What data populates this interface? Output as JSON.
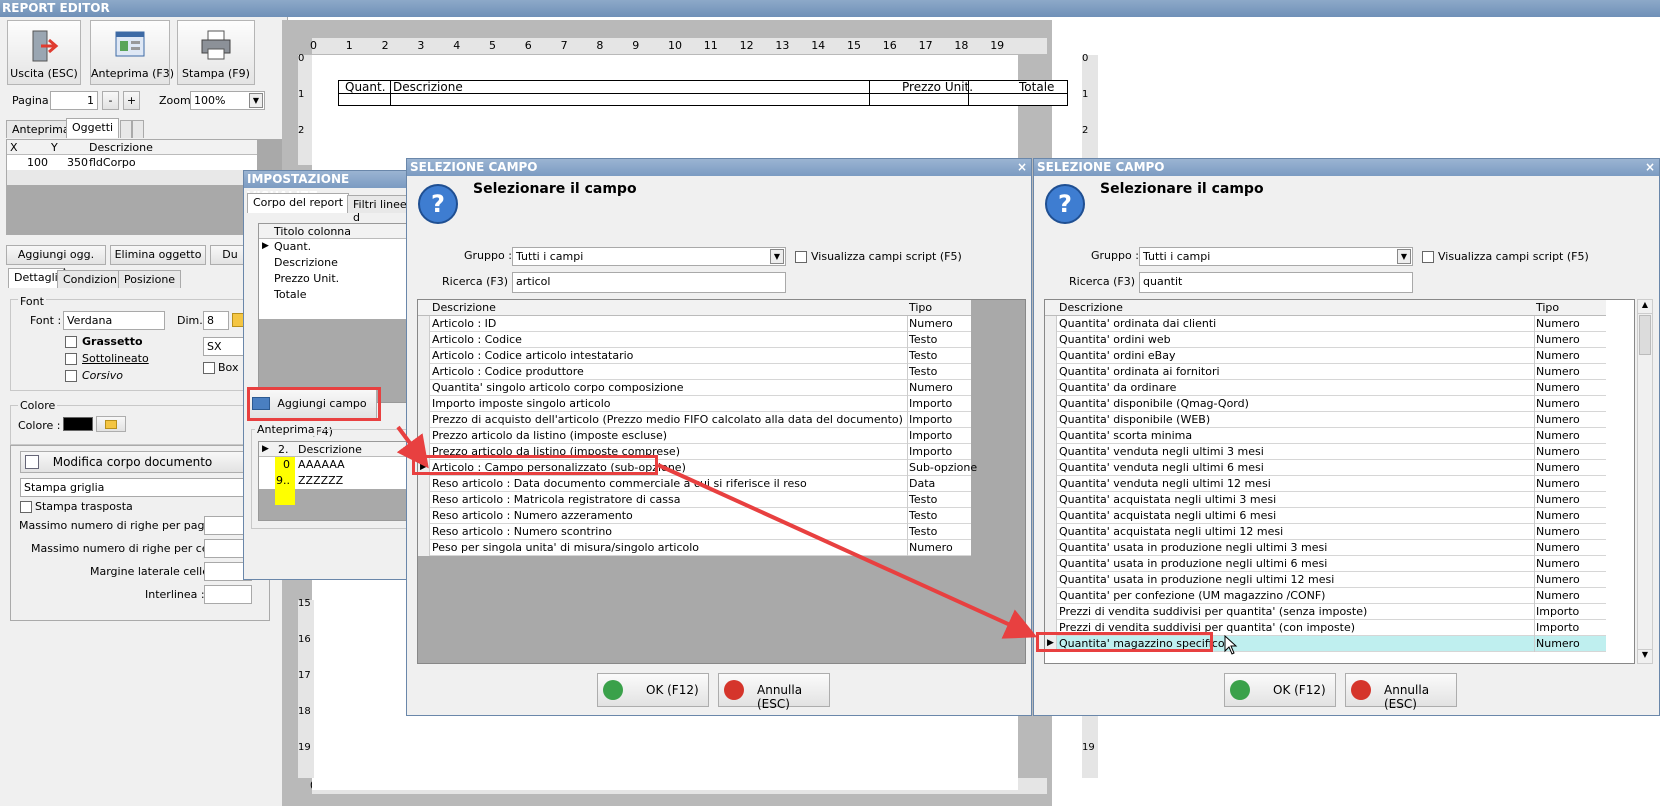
{
  "window": {
    "title": "REPORT EDITOR"
  },
  "toolbar": {
    "exit": "Uscita (ESC)",
    "preview": "Anteprima (F3)",
    "print": "Stampa (F9)"
  },
  "paging": {
    "page_label": "Pagina",
    "page_value": "1",
    "minus": "-",
    "plus": "+",
    "zoom_label": "Zoom",
    "zoom_value": "100%"
  },
  "left_tabs": {
    "preview": "Anteprima",
    "objects": "Oggetti"
  },
  "objects_grid": {
    "headers": [
      "X",
      "Y",
      "Descrizione"
    ],
    "rows": [
      {
        "x": "100",
        "y": "350",
        "desc": "fldCorpo"
      }
    ]
  },
  "object_buttons": {
    "add": "Aggiungi ogg.(F4)",
    "delete": "Elimina oggetto",
    "dup": "Du"
  },
  "detail_tabs": {
    "details": "Dettagli",
    "conditions": "Condizioni",
    "position": "Posizione"
  },
  "font_group": {
    "title": "Font",
    "font_label": "Font :",
    "font_value": "Verdana",
    "dim_label": "Dim.",
    "dim_value": "8",
    "bold": "Grassetto",
    "underline": "Sottolineato",
    "italic": "Corsivo",
    "align_value": "SX",
    "box": "Box"
  },
  "color_group": {
    "title": "Colore",
    "color_label": "Colore :",
    "color_value": "#000000"
  },
  "body_section": {
    "modify_btn": "Modifica corpo documento",
    "grid_select": "Stampa griglia",
    "transposed": "Stampa trasposta",
    "max_rows_page": "Massimo numero di righe per pagina :",
    "max_rows_cell": "Massimo numero di righe per cella :",
    "margin": "Margine laterale celle :",
    "line_spacing": "Interlinea :"
  },
  "ruler": {
    "h_ticks": [
      "0",
      "1",
      "2",
      "3",
      "4",
      "5",
      "6",
      "7",
      "8",
      "9",
      "10",
      "11",
      "12",
      "13",
      "14",
      "15",
      "16",
      "17",
      "18",
      "19"
    ],
    "v_ticks_top": [
      "0",
      "1",
      "2"
    ],
    "v_ticks_bottom": [
      "15",
      "16",
      "17",
      "18",
      "19"
    ]
  },
  "report_table": {
    "headers": [
      "Quant.",
      "Descrizione",
      "Prezzo Unit.",
      "Totale"
    ]
  },
  "setup_dialog": {
    "title": "IMPOSTAZIONE VISUALIZZ",
    "tab_body": "Corpo del report",
    "tab_filters": "Filtri linee d",
    "col_header": "Titolo colonna",
    "columns": [
      "Quant.",
      "Descrizione",
      "Prezzo Unit.",
      "Totale"
    ],
    "add_field": "Aggiungi campo (F4)",
    "preview_label": "Anteprima",
    "preview_header_num": "2.",
    "preview_header_desc": "Descrizione",
    "preview_rows": [
      {
        "n": "0",
        "d": "AAAAAA"
      },
      {
        "n": "9..",
        "d": "ZZZZZZ"
      }
    ]
  },
  "dialog1": {
    "title": "SELEZIONE CAMPO",
    "close": "×",
    "heading": "Selezionare il campo",
    "group_label": "Gruppo :",
    "group_value": "Tutti i campi",
    "script_chk": "Visualizza campi script (F5)",
    "search_label": "Ricerca (F3) :",
    "search_value": "articol",
    "col_desc": "Descrizione",
    "col_type": "Tipo",
    "rows": [
      {
        "d": "Articolo : ID",
        "t": "Numero"
      },
      {
        "d": "Articolo : Codice",
        "t": "Testo"
      },
      {
        "d": "Articolo : Codice articolo intestatario",
        "t": "Testo"
      },
      {
        "d": "Articolo : Codice produttore",
        "t": "Testo"
      },
      {
        "d": "Quantita' singolo articolo corpo composizione",
        "t": "Numero"
      },
      {
        "d": "Importo imposte singolo articolo",
        "t": "Importo"
      },
      {
        "d": "Prezzo di acquisto dell'articolo (Prezzo medio FIFO calcolato alla data del documento)",
        "t": "Importo"
      },
      {
        "d": "Prezzo articolo da listino (imposte escluse)",
        "t": "Importo"
      },
      {
        "d": "Prezzo articolo da listino (imposte comprese)",
        "t": "Importo"
      },
      {
        "d": "Articolo : Campo personalizzato (sub-opzione)",
        "t": "Sub-opzione"
      },
      {
        "d": "Reso articolo : Data documento commerciale a cui si riferisce il reso",
        "t": "Data"
      },
      {
        "d": "Reso articolo : Matricola registratore di cassa",
        "t": "Testo"
      },
      {
        "d": "Reso articolo : Numero azzeramento",
        "t": "Testo"
      },
      {
        "d": "Reso articolo : Numero scontrino",
        "t": "Testo"
      },
      {
        "d": "Peso per singola unita' di misura/singolo articolo",
        "t": "Numero"
      }
    ],
    "ok": "OK (F12)",
    "cancel": "Annulla (ESC)"
  },
  "dialog2": {
    "title": "SELEZIONE CAMPO",
    "close": "×",
    "heading": "Selezionare il campo",
    "group_label": "Gruppo :",
    "group_value": "Tutti i campi",
    "script_chk": "Visualizza campi script (F5)",
    "search_label": "Ricerca (F3) :",
    "search_value": "quantit",
    "col_desc": "Descrizione",
    "col_type": "Tipo",
    "rows": [
      {
        "d": "Quantita' ordinata dai clienti",
        "t": "Numero"
      },
      {
        "d": "Quantita' ordini web",
        "t": "Numero"
      },
      {
        "d": "Quantita' ordini eBay",
        "t": "Numero"
      },
      {
        "d": "Quantita' ordinata ai fornitori",
        "t": "Numero"
      },
      {
        "d": "Quantita' da ordinare",
        "t": "Numero"
      },
      {
        "d": "Quantita' disponibile (Qmag-Qord)",
        "t": "Numero"
      },
      {
        "d": "Quantita' disponibile (WEB)",
        "t": "Numero"
      },
      {
        "d": "Quantita' scorta minima",
        "t": "Numero"
      },
      {
        "d": "Quantita' venduta negli ultimi 3 mesi",
        "t": "Numero"
      },
      {
        "d": "Quantita' venduta negli ultimi 6 mesi",
        "t": "Numero"
      },
      {
        "d": "Quantita' venduta negli ultimi 12 mesi",
        "t": "Numero"
      },
      {
        "d": "Quantita' acquistata negli ultimi 3 mesi",
        "t": "Numero"
      },
      {
        "d": "Quantita' acquistata negli ultimi 6 mesi",
        "t": "Numero"
      },
      {
        "d": "Quantita' acquistata negli ultimi 12 mesi",
        "t": "Numero"
      },
      {
        "d": "Quantita' usata in produzione negli ultimi 3 mesi",
        "t": "Numero"
      },
      {
        "d": "Quantita' usata in produzione negli ultimi 6 mesi",
        "t": "Numero"
      },
      {
        "d": "Quantita' usata in produzione negli ultimi 12 mesi",
        "t": "Numero"
      },
      {
        "d": "Quantita' per confezione (UM magazzino /CONF)",
        "t": "Numero"
      },
      {
        "d": "Prezzi di vendita suddivisi per quantita' (senza imposte)",
        "t": "Importo"
      },
      {
        "d": "Prezzi di vendita suddivisi per quantita' (con imposte)",
        "t": "Importo"
      },
      {
        "d": "Quantita' magazzino specifico",
        "t": "Numero"
      }
    ],
    "ok": "OK (F12)",
    "cancel": "Annulla (ESC)"
  }
}
